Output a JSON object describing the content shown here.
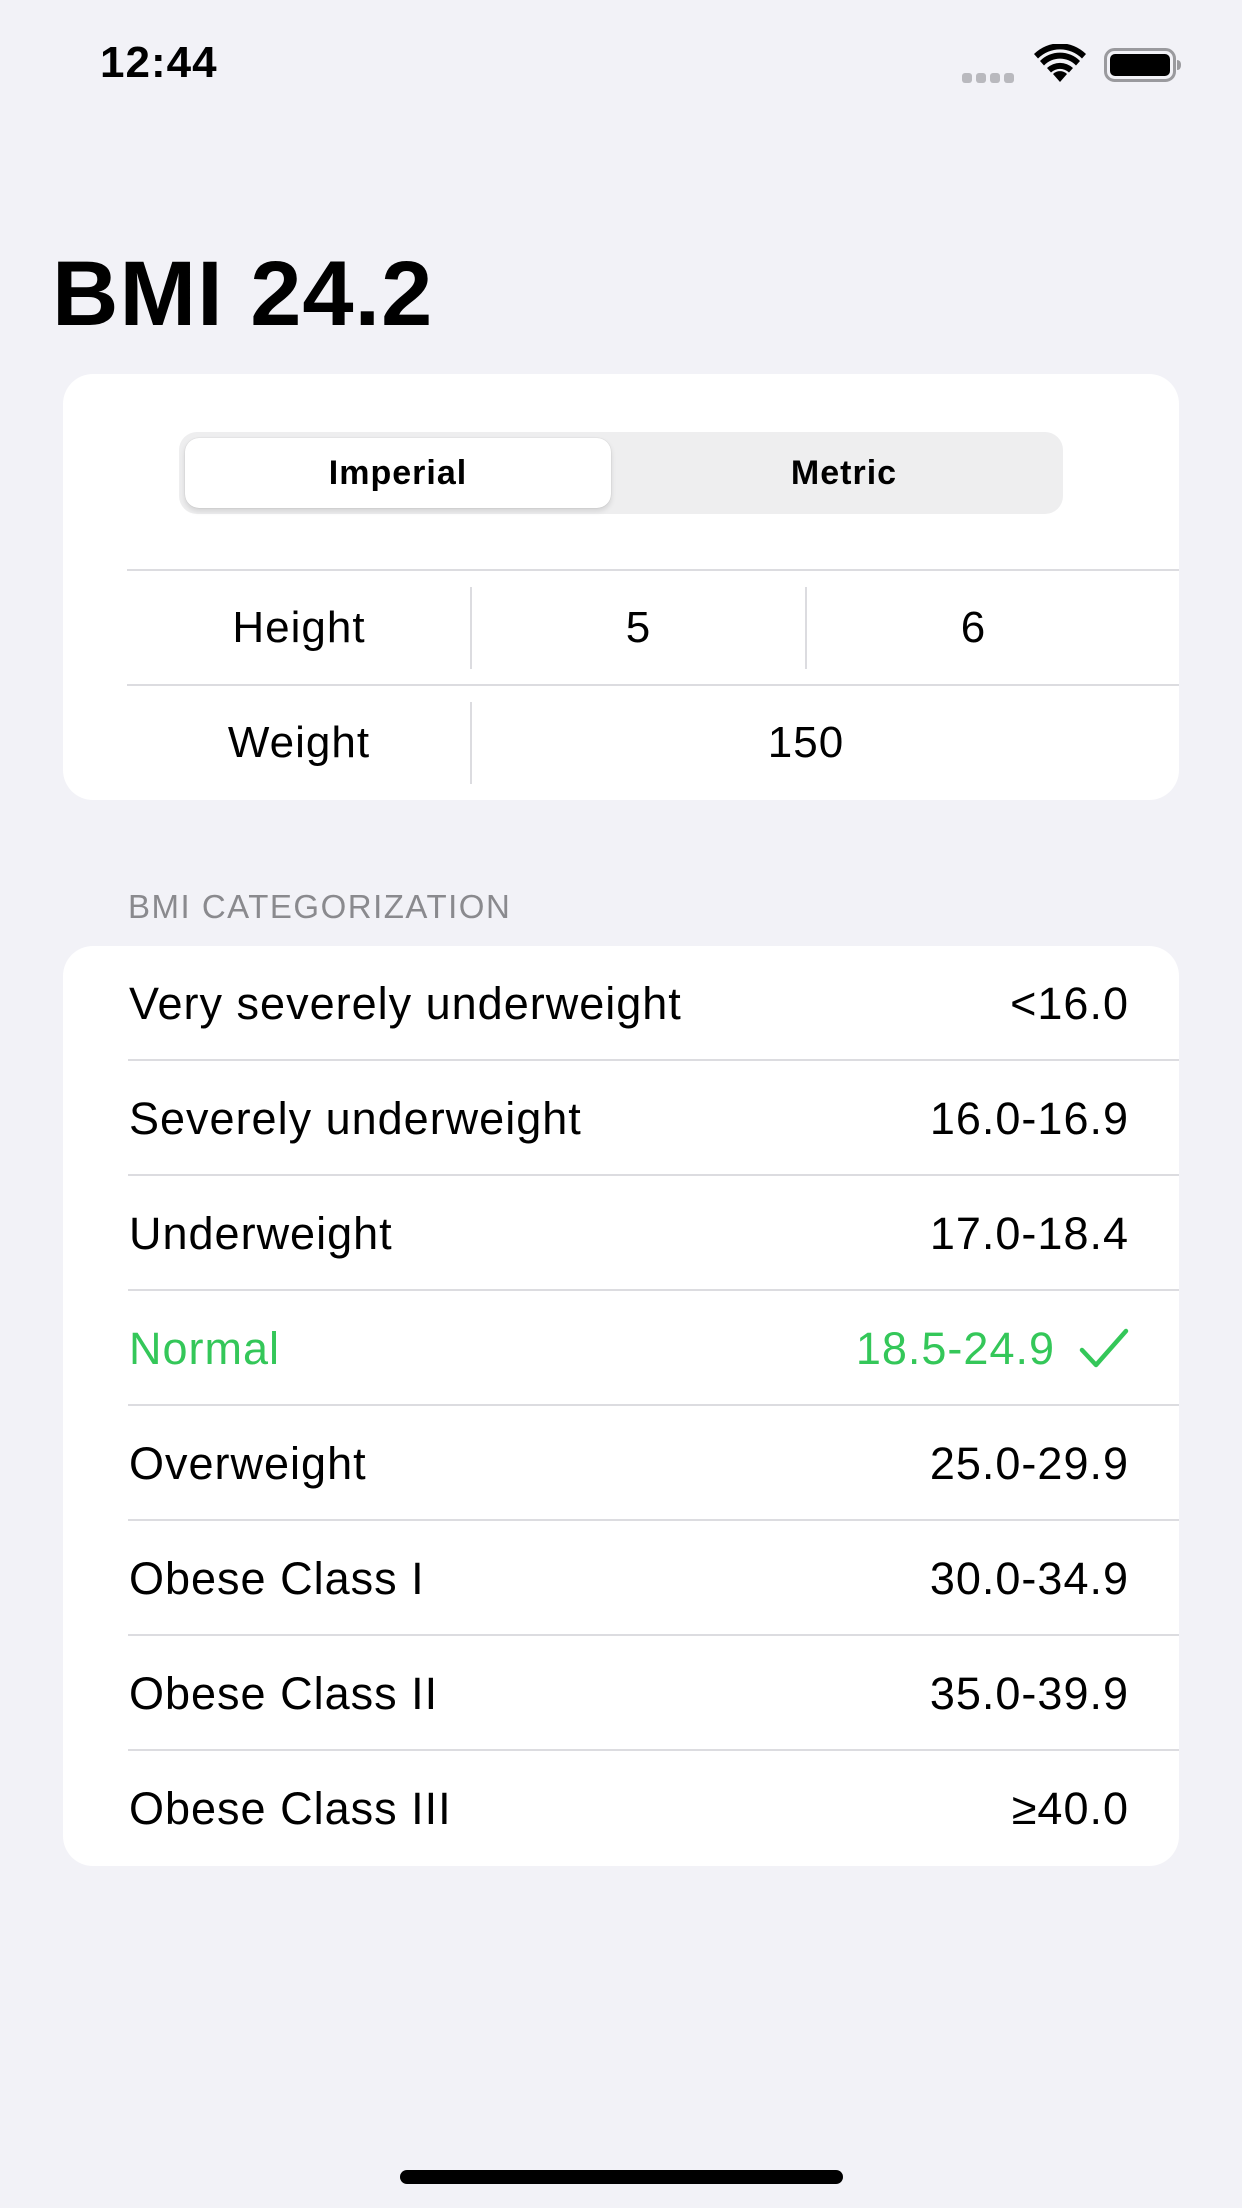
{
  "status_bar": {
    "time": "12:44"
  },
  "title": "BMI 24.2",
  "unit_toggle": {
    "options": [
      "Imperial",
      "Metric"
    ],
    "selected": "Imperial"
  },
  "inputs": {
    "height": {
      "label": "Height",
      "feet": "5",
      "inches": "6"
    },
    "weight": {
      "label": "Weight",
      "value": "150"
    }
  },
  "categorization": {
    "header": "BMI CATEGORIZATION",
    "rows": [
      {
        "label": "Very severely underweight",
        "range": "<16.0"
      },
      {
        "label": "Severely underweight",
        "range": "16.0-16.9"
      },
      {
        "label": "Underweight",
        "range": "17.0-18.4"
      },
      {
        "label": "Normal",
        "range": "18.5-24.9",
        "selected": true
      },
      {
        "label": "Overweight",
        "range": "25.0-29.9"
      },
      {
        "label": "Obese Class I",
        "range": "30.0-34.9"
      },
      {
        "label": "Obese Class II",
        "range": "35.0-39.9"
      },
      {
        "label": "Obese Class III",
        "range": "≥40.0"
      }
    ]
  },
  "colors": {
    "background": "#f2f2f7",
    "card": "#ffffff",
    "accent_green": "#34c759",
    "secondary_text": "#8a8a8e"
  },
  "icons": [
    "signal-icon",
    "wifi-icon",
    "battery-icon",
    "checkmark-icon"
  ]
}
